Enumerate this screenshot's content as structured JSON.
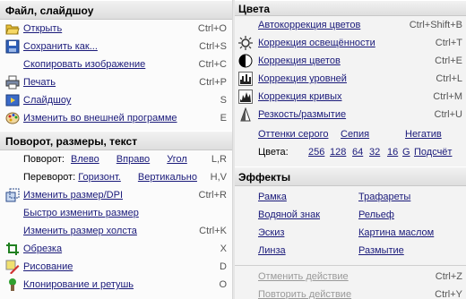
{
  "file": {
    "title": "Файл, слайдшоу",
    "items": [
      {
        "label": "Открыть",
        "shortcut": "Ctrl+O",
        "icon": "open-folder-icon"
      },
      {
        "label": "Сохранить как...",
        "shortcut": "Ctrl+S",
        "icon": "save-icon"
      },
      {
        "label": "Скопировать изображение",
        "shortcut": "Ctrl+C",
        "icon": ""
      },
      {
        "label": "Печать",
        "shortcut": "Ctrl+P",
        "icon": "printer-icon"
      },
      {
        "label": "Слайдшоу",
        "shortcut": "S",
        "icon": "slideshow-icon"
      },
      {
        "label": "Изменить во внешней программе",
        "shortcut": "E",
        "icon": "palette-icon"
      }
    ]
  },
  "transform": {
    "title": "Поворот, размеры, текст",
    "rotate": {
      "label": "Поворот:",
      "left": "Влево",
      "right": "Вправо",
      "angle": "Угол",
      "shortcut": "L,R"
    },
    "flip": {
      "label": "Переворот:",
      "horizontal": "Горизонт.",
      "vertical": "Вертикально",
      "shortcut": "H,V"
    },
    "items": [
      {
        "label": "Изменить размер/DPI",
        "shortcut": "Ctrl+R",
        "icon": "resize-icon"
      },
      {
        "label": "Быстро изменить размер",
        "shortcut": "",
        "icon": ""
      },
      {
        "label": "Изменить размер холста",
        "shortcut": "Ctrl+K",
        "icon": ""
      },
      {
        "label": "Обрезка",
        "shortcut": "X",
        "icon": "crop-icon"
      },
      {
        "label": "Рисование",
        "shortcut": "D",
        "icon": "draw-icon"
      },
      {
        "label": "Клонирование и ретушь",
        "shortcut": "O",
        "icon": "clone-icon"
      }
    ]
  },
  "colors": {
    "title": "Цвета",
    "items": [
      {
        "label": "Автокоррекция цветов",
        "shortcut": "Ctrl+Shift+B",
        "icon": ""
      },
      {
        "label": "Коррекция освещённости",
        "shortcut": "Ctrl+T",
        "icon": "sun-icon"
      },
      {
        "label": "Коррекция цветов",
        "shortcut": "Ctrl+E",
        "icon": "color-circle-icon"
      },
      {
        "label": "Коррекция уровней",
        "shortcut": "Ctrl+L",
        "icon": "levels-icon"
      },
      {
        "label": "Коррекция кривых",
        "shortcut": "Ctrl+M",
        "icon": "curves-icon"
      },
      {
        "label": "Резкость/размытие",
        "shortcut": "Ctrl+U",
        "icon": "sharpen-icon"
      }
    ],
    "modes": [
      "Оттенки серого",
      "Сепия",
      "Негатив"
    ],
    "count_label": "Цвета:",
    "counts": [
      "256",
      "128",
      "64",
      "32",
      "16",
      "G",
      "Подсчёт"
    ]
  },
  "effects": {
    "title": "Эффекты",
    "left": [
      "Рамка",
      "Водяной знак",
      "Эскиз",
      "Линза"
    ],
    "right": [
      "Трафареты",
      "Рельеф",
      "Картина маслом",
      "Размытие"
    ]
  },
  "history": {
    "undo": {
      "label": "Отменить действие",
      "shortcut": "Ctrl+Z"
    },
    "redo": {
      "label": "Повторить действие",
      "shortcut": "Ctrl+Y"
    }
  },
  "accent": "#1a1a7a"
}
